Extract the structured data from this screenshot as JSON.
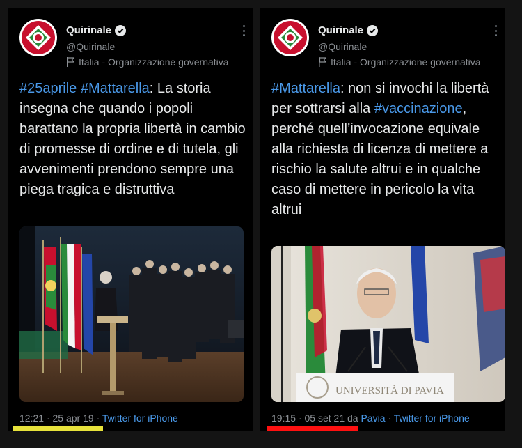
{
  "tweets": [
    {
      "account_name": "Quirinale",
      "handle": "@Quirinale",
      "label": "Italia - Organizzazione governativa",
      "text_parts": [
        {
          "text": "#25aprile",
          "hashtag": true
        },
        {
          "text": " ",
          "hashtag": false
        },
        {
          "text": "#Mattarella",
          "hashtag": true
        },
        {
          "text": ": La storia insegna che quando i popoli barattano la propria libertà in cambio di promesse di ordine e di tutela, gli avvenimenti prendono sempre una piega tragica e distruttiva",
          "hashtag": false
        }
      ],
      "time": "12:21",
      "date": "25 apr 19",
      "source": "Twitter for iPhone",
      "underline_color": "#e7e23b"
    },
    {
      "account_name": "Quirinale",
      "handle": "@Quirinale",
      "label": "Italia - Organizzazione governativa",
      "text_parts": [
        {
          "text": "#Mattarella",
          "hashtag": true
        },
        {
          "text": ": non si invochi la libertà per sottrarsi alla ",
          "hashtag": false
        },
        {
          "text": "#vaccinazione",
          "hashtag": true
        },
        {
          "text": ", perché quell’invocazione equivale alla richiesta di licenza di mettere a rischio la salute altrui e in qualche caso di mettere in pericolo la vita altrui",
          "hashtag": false
        }
      ],
      "time": "19:15",
      "date": "05 set 21",
      "location_prefix": "da",
      "location": "Pavia",
      "source": "Twitter for iPhone",
      "podium_text": "UNIVERSITÀ DI PAVIA",
      "underline_color": "#ff1010"
    }
  ],
  "separator": "·",
  "colors": {
    "link": "#4a99e9",
    "text": "#e7e9ea",
    "muted": "#8b8f94",
    "background": "#000000"
  }
}
